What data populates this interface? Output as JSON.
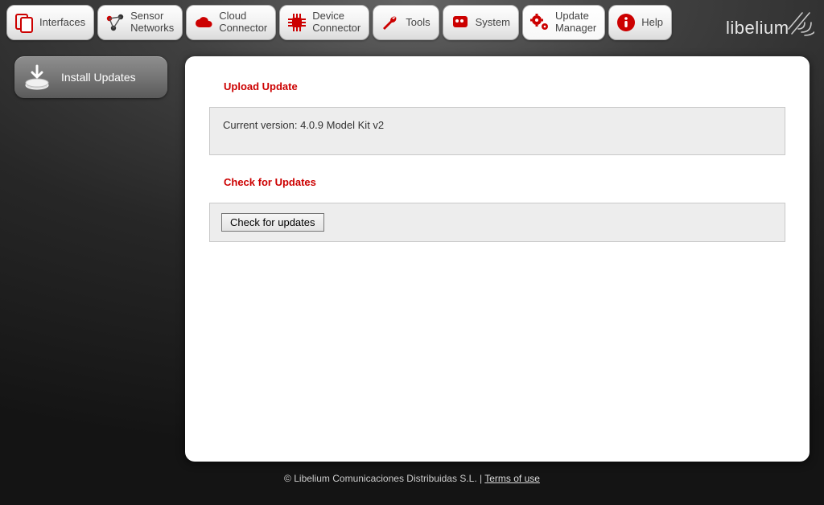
{
  "nav": {
    "interfaces": "Interfaces",
    "sensor_networks": "Sensor\nNetworks",
    "cloud_connector": "Cloud\nConnector",
    "device_connector": "Device\nConnector",
    "tools": "Tools",
    "system": "System",
    "update_manager": "Update\nManager",
    "help": "Help"
  },
  "brand": "libelium",
  "sidebar": {
    "install_updates": "Install Updates"
  },
  "sections": {
    "upload_update": "Upload Update",
    "check_for_updates": "Check for Updates"
  },
  "version_line": "Current version: 4.0.9 Model Kit v2",
  "buttons": {
    "check_for_updates": "Check for updates"
  },
  "footer": {
    "copyright": "© Libelium Comunicaciones Distribuidas S.L.",
    "separator": " | ",
    "terms": "Terms of use"
  }
}
